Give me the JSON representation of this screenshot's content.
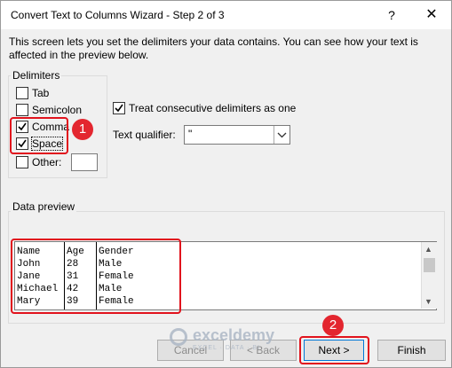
{
  "window": {
    "title": "Convert Text to Columns Wizard - Step 2 of 3",
    "help_label": "?",
    "close_label": "✕"
  },
  "intro_text": "This screen lets you set the delimiters your data contains.  You can see how your text is affected in the preview below.",
  "delimiters": {
    "title": "Delimiters",
    "tab": {
      "label": "Tab",
      "checked": false
    },
    "semicolon": {
      "label": "Semicolon",
      "checked": false
    },
    "comma": {
      "label": "Comma",
      "checked": true
    },
    "space": {
      "label": "Space",
      "checked": true
    },
    "other": {
      "label": "Other:",
      "checked": false,
      "value": ""
    }
  },
  "consecutive": {
    "label": "Treat consecutive delimiters as one",
    "checked": true
  },
  "qualifier": {
    "label": "Text qualifier:",
    "value": "\""
  },
  "preview": {
    "title": "Data preview",
    "columns": [
      "Name",
      "Age",
      "Gender"
    ],
    "rows": [
      [
        "John",
        "28",
        "Male"
      ],
      [
        "Jane",
        "31",
        "Female"
      ],
      [
        "Michael",
        "42",
        "Male"
      ],
      [
        "Mary",
        "39",
        "Female"
      ]
    ]
  },
  "buttons": {
    "cancel": "Cancel",
    "back": "< Back",
    "next": "Next >",
    "finish": "Finish"
  },
  "annotations": {
    "badge1": "1",
    "badge2": "2",
    "highlight_color": "#e1131d"
  },
  "watermark": {
    "name": "exceldemy",
    "tagline": "EXCEL · DATA · BI"
  }
}
